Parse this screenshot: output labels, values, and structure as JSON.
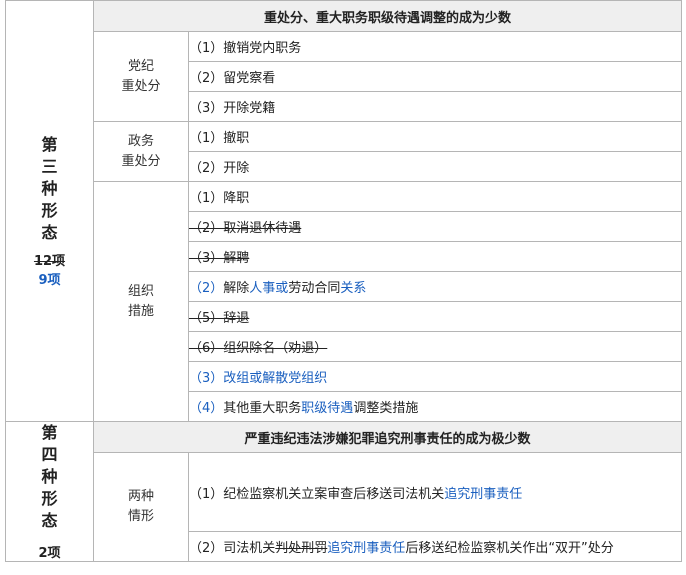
{
  "third_form": {
    "label_chars": [
      "第",
      "三",
      "种",
      "形",
      "态"
    ],
    "count_old": "12项",
    "count_new": "9项",
    "header": "重处分、重大职务职级待遇调整的成为少数",
    "party_category": [
      "党纪",
      "重处分"
    ],
    "party_items": [
      "（1）撤销党内职务",
      "（2）留党察看",
      "（3）开除党籍"
    ],
    "gov_category": [
      "政务",
      "重处分"
    ],
    "gov_items": [
      "（1）撤职",
      "（2）开除"
    ],
    "org_category": [
      "组织",
      "措施"
    ],
    "org_item1": "（1）降职",
    "org_item2": "（2）取消退休待遇",
    "org_item3": "（3）解聘",
    "org_item4": {
      "num": "（2）",
      "a": "解除",
      "b": "人事或",
      "c": "劳动合同",
      "d": "关系"
    },
    "org_item5": "（5）辞退",
    "org_item6": "（6）组织除名（劝退）",
    "org_item7": "（3）改组或解散党组织",
    "org_item8": {
      "num": "（4）",
      "a": "其他重大职务",
      "b": "职级待遇",
      "c": "调整类措施"
    }
  },
  "fourth_form": {
    "label_chars": [
      "第",
      "四",
      "种",
      "形",
      "态"
    ],
    "count": "2项",
    "header": "严重违纪违法涉嫌犯罪追究刑事责任的成为极少数",
    "category": [
      "两种",
      "情形"
    ],
    "item1": {
      "a": "（1）纪检监察机关立案审查后移送司法机关",
      "b": "追究刑事责任"
    },
    "item2": {
      "a": "（2）司法机关",
      "b": "判处刑罚",
      "c": "追究刑事责任",
      "d": "后移送纪检监察机关作出“双开”处分"
    }
  },
  "colors": {
    "highlight_blue": "#1a5fbf",
    "header_bg": "#efefef",
    "border": "#b5b5b5"
  }
}
